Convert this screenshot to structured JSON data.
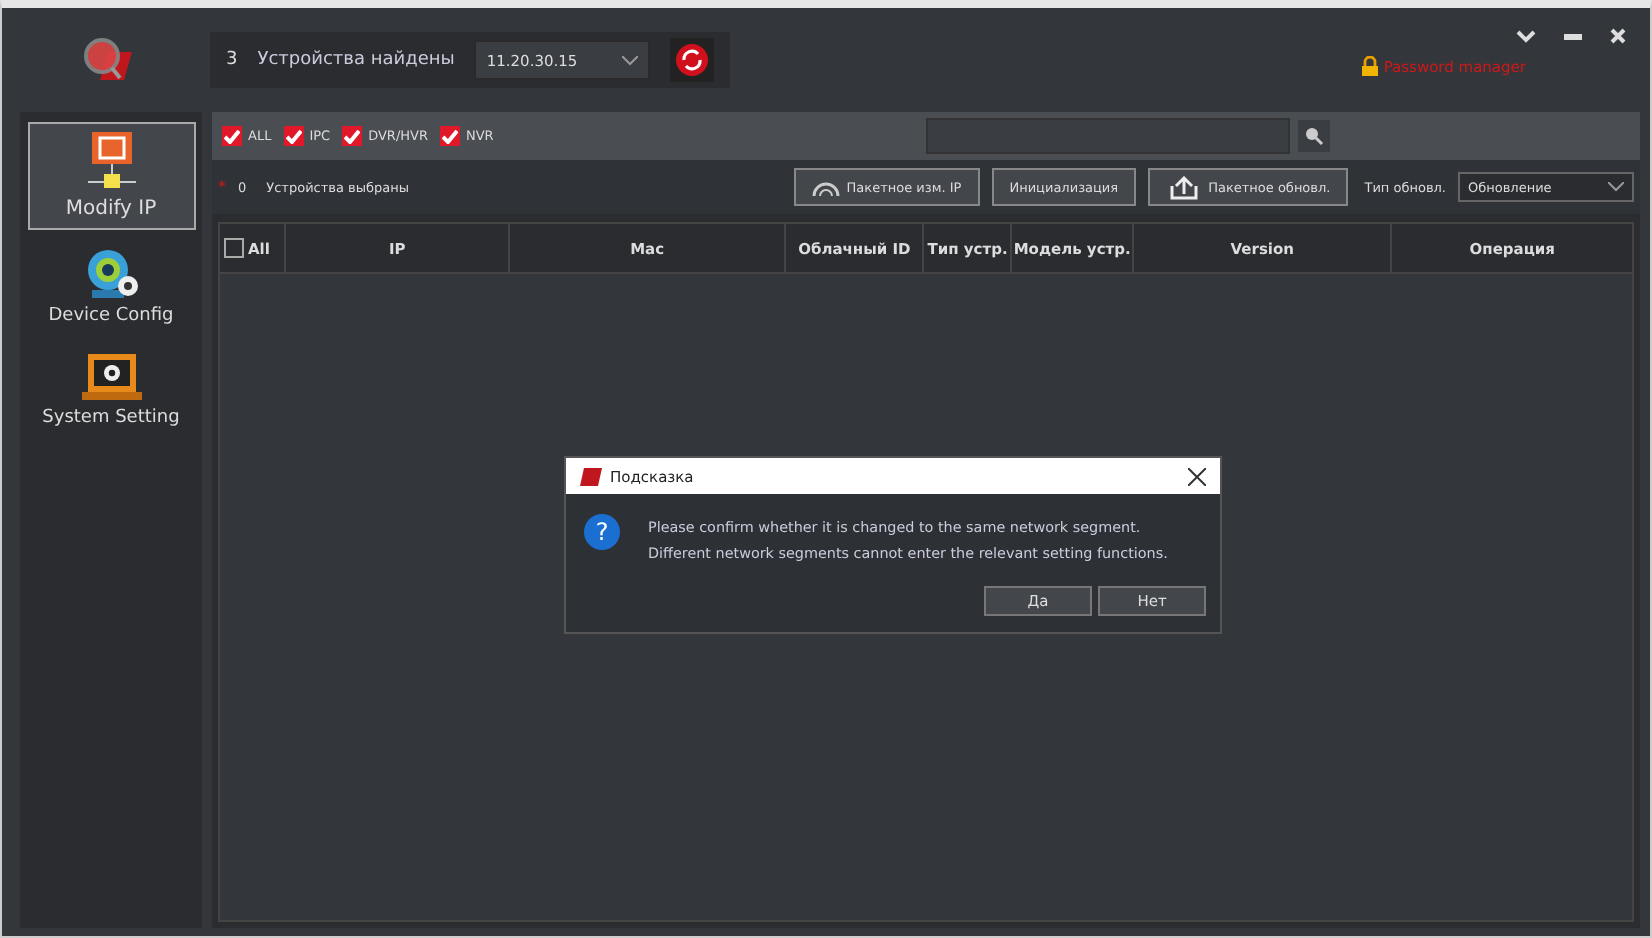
{
  "header": {
    "count": "3",
    "label": "Устройства найдены",
    "ip_select": "11.20.30.15",
    "password_manager": "Password manager"
  },
  "sidebar": {
    "items": [
      {
        "label": "Modify IP",
        "selected": true
      },
      {
        "label": "Device Config",
        "selected": false
      },
      {
        "label": "System Setting",
        "selected": false
      }
    ]
  },
  "filters": [
    {
      "label": "ALL",
      "checked": true
    },
    {
      "label": "IPC",
      "checked": true
    },
    {
      "label": "DVR/HVR",
      "checked": true
    },
    {
      "label": "NVR",
      "checked": true
    }
  ],
  "toolbar": {
    "required_mark": "*",
    "selected_count": "0",
    "selected_label": "Устройства выбраны",
    "buttons": [
      "Пакетное изм. IP",
      "Инициализация",
      "Пакетное обновл."
    ],
    "update_type_label": "Тип обновл.",
    "update_type": "Обновление"
  },
  "table": {
    "select_all": {
      "label": "All",
      "checked": false
    },
    "columns": [
      "IP",
      "Mac",
      "Облачный ID",
      "Тип устр.",
      "Модель устр.",
      "Version",
      "Операция"
    ]
  },
  "dialog": {
    "title": "Подсказка",
    "icon_glyph": "?",
    "message": "Please confirm whether it is changed to the same network segment.\nDifferent network segments cannot enter the relevant setting functions.",
    "buttons": [
      "Да",
      "Нет"
    ]
  }
}
